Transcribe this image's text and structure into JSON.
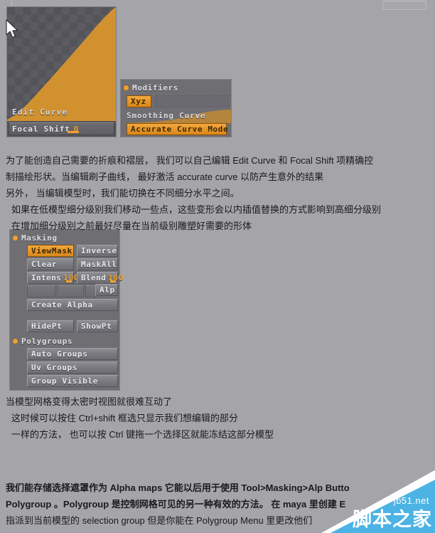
{
  "edit_curve": {
    "title": "Edit Curve",
    "focal_shift_label": "Focal Shift",
    "focal_shift_value": "0"
  },
  "modifiers": {
    "title": "Modifiers",
    "xyz_label": "Xyz",
    "smoothing_curve_label": "Smoothing Curve",
    "accurate_curve_label": "Accurate Curve Mode"
  },
  "masking": {
    "title": "Masking",
    "view_mask": "ViewMask",
    "inverse": "Inverse",
    "clear": "Clear",
    "mask_all": "MaskAll",
    "intens_label": "Intens",
    "intens_value": "100",
    "blend_label": "Blend",
    "blend_value": "100",
    "alp": "Alp",
    "create_alpha": "Create Alpha",
    "hide_pt": "HidePt",
    "show_pt": "ShowPt"
  },
  "polygroups": {
    "title": "Polygroups",
    "auto_groups": "Auto Groups",
    "uv_groups": "Uv Groups",
    "group_visible": "Group Visible"
  },
  "paragraph_1": {
    "lines": [
      "为了能创造自己需要的折痕和褶层， 我们可以自己编辑 Edit Curve 和 Focal Shift 项精确控",
      "制描绘形状。当编辑刷子曲线， 最好激活 accurate curve 以防产生意外的结果",
      "另外， 当编辑模型时，我们能切换在不同细分水平之间。",
      "如果在低模型细分级别我们移动一些点，这些变形会以内插值替换的方式影响到高细分级别",
      "在增加细分级别之前最好尽量在当前级别雕塑好需要的形体"
    ]
  },
  "paragraph_2": {
    "lines": [
      "当模型网格变得太密时视图就很难互动了",
      "这时候可以按住 Ctrl+shift 框选只显示我们想编辑的部分",
      "一样的方法， 也可以按 Ctrl 键拖一个选择区就能冻结这部分模型"
    ]
  },
  "paragraph_3": {
    "lines": [
      "我们能存储选择遮罩作为 Alpha maps 它能以后用于使用 Tool>Masking>Alp Butto",
      "Polygroup 。Polygroup 是控制网格可见的另一种有效的方法。 在 maya 里创建 E",
      "指派到当前模型的 selection group 但是你能在 Polygroup Menu 里更改他们"
    ]
  },
  "watermark": {
    "url": "jb51.net",
    "name": "脚本之家"
  },
  "colors": {
    "page_background": "#a5a5a9",
    "panel_background": "#6e6e73",
    "accent_orange": "#f0a02c",
    "curve_fill": "#d1912f",
    "watermark_blue": "#4cb3e4"
  }
}
